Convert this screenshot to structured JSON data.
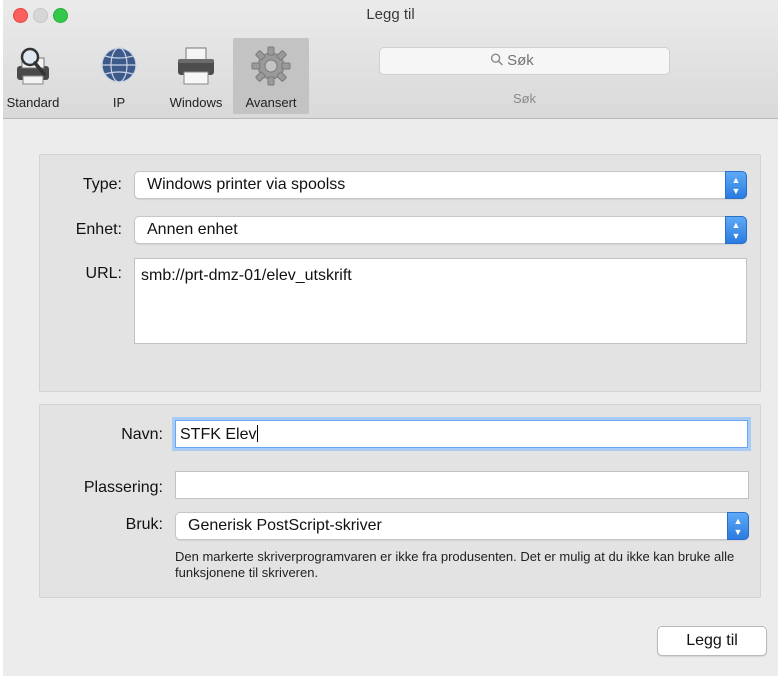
{
  "window": {
    "title": "Legg til"
  },
  "toolbar": {
    "items": [
      {
        "label": "Standard",
        "icon": "standard-printer-icon"
      },
      {
        "label": "IP",
        "icon": "globe-icon"
      },
      {
        "label": "Windows",
        "icon": "printer-icon"
      },
      {
        "label": "Avansert",
        "icon": "gear-icon",
        "active": true
      }
    ],
    "search": {
      "placeholder": "Søk",
      "caption": "Søk"
    }
  },
  "connection": {
    "type_label": "Type:",
    "type_value": "Windows printer via spoolss",
    "device_label": "Enhet:",
    "device_value": "Annen enhet",
    "url_label": "URL:",
    "url_value": "smb://prt-dmz-01/elev_utskrift"
  },
  "printer": {
    "name_label": "Navn:",
    "name_value": "STFK Elev",
    "location_label": "Plassering:",
    "location_value": "",
    "use_label": "Bruk:",
    "use_value": "Generisk PostScript-skriver",
    "note": "Den markerte skriverprogramvaren er ikke fra produsenten. Det er mulig at du ikke kan bruke alle funksjonene til skriveren."
  },
  "actions": {
    "add_label": "Legg til"
  },
  "colors": {
    "accent": "#2a7be0",
    "focus_ring": "#a9ccf6"
  }
}
